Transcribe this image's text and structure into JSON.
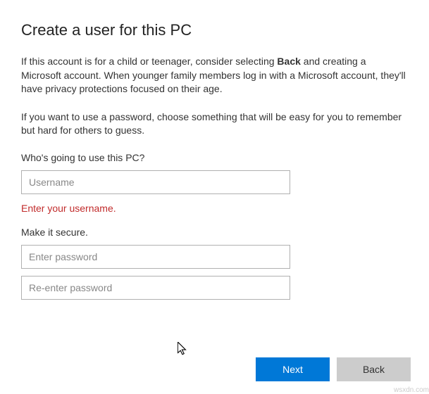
{
  "title": "Create a user for this PC",
  "desc1_pre": "If this account is for a child or teenager, consider selecting ",
  "desc1_bold": "Back",
  "desc1_post": " and creating a Microsoft account. When younger family members log in with a Microsoft account, they'll have privacy protections focused on their age.",
  "desc2": "If you want to use a password, choose something that will be easy for you to remember but hard for others to guess.",
  "username": {
    "label": "Who's going to use this PC?",
    "placeholder": "Username",
    "error": "Enter your username."
  },
  "password": {
    "label": "Make it secure.",
    "placeholder1": "Enter password",
    "placeholder2": "Re-enter password"
  },
  "buttons": {
    "next": "Next",
    "back": "Back"
  },
  "watermark": "wsxdn.com"
}
